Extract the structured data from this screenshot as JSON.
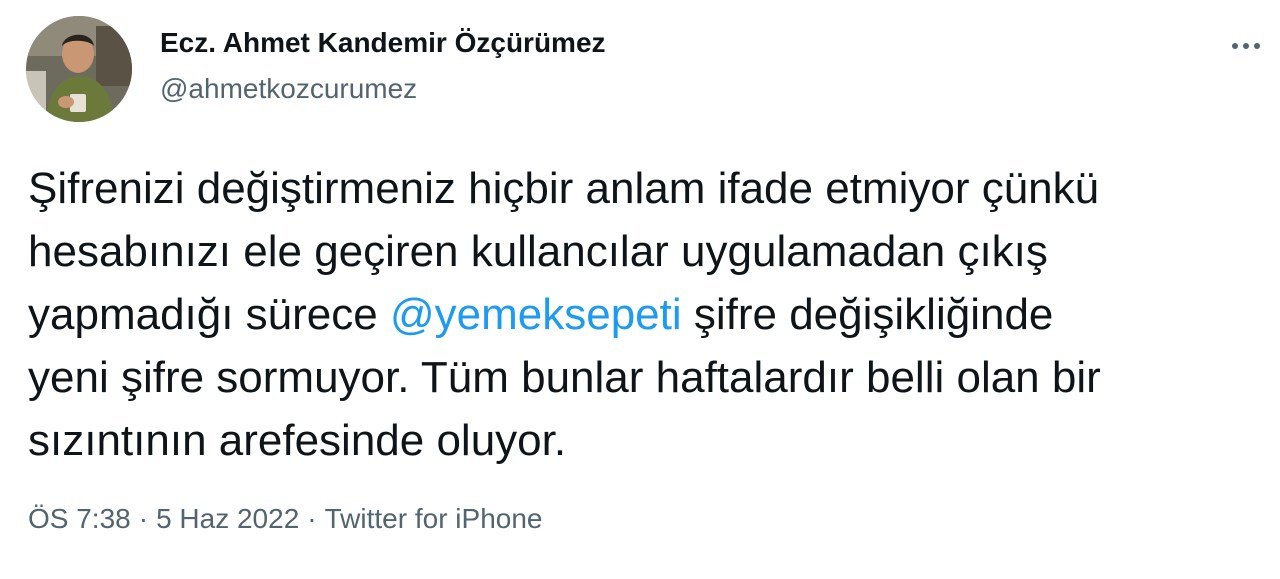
{
  "author": {
    "display_name": "Ecz. Ahmet Kandemir Özçürümez",
    "handle": "@ahmetkozcurumez"
  },
  "tweet": {
    "lines": {
      "l1": "Şifrenizi değiştirmeniz hiçbir anlam ifade etmiyor çünkü",
      "l2": "hesabınızı ele geçiren kullancılar uygulamadan çıkış",
      "l3_pre": "yapmadığı sürece ",
      "l3_mention": "@yemeksepeti",
      "l3_post": " şifre değişikliğinde",
      "l4": "yeni şifre sormuyor. Tüm bunlar haftalardır belli olan bir",
      "l5": "sızıntının arefesinde oluyor."
    }
  },
  "meta": {
    "time": "ÖS 7:38",
    "date": "5 Haz 2022",
    "source": "Twitter for iPhone",
    "separator": "·"
  },
  "icons": {
    "more": "more-horizontal-icon"
  },
  "colors": {
    "text": "#0f1419",
    "secondary": "#536471",
    "link": "#1d9bf0"
  }
}
